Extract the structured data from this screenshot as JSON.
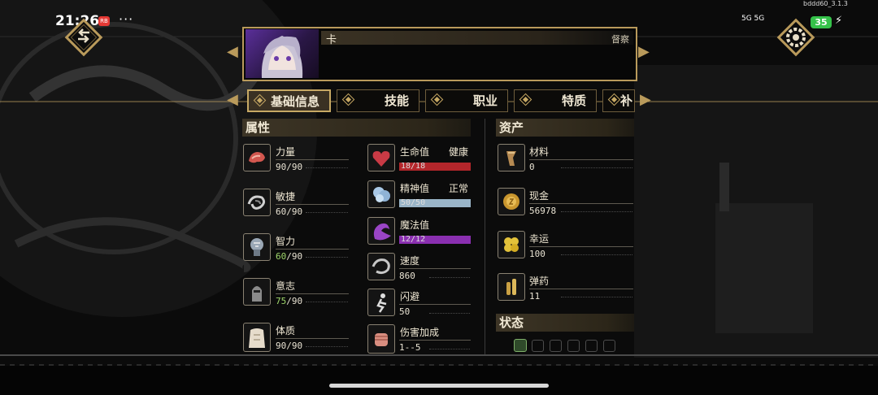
{
  "status_bar": {
    "time": "21:26",
    "app_badge": "RB",
    "dots": "···",
    "network": "5G  5G",
    "battery": "35",
    "version": "bddd60_3.1.3"
  },
  "character": {
    "name": "卡",
    "tag": "督察"
  },
  "tabs": [
    {
      "label": "基础信息",
      "active": true
    },
    {
      "label": "技能"
    },
    {
      "label": "职业"
    },
    {
      "label": "特质"
    },
    {
      "label": "补"
    }
  ],
  "attributes": {
    "title": "属性",
    "items": [
      {
        "label": "力量",
        "value": "90/90",
        "icon": "arm-icon"
      },
      {
        "label": "敏捷",
        "value": "60/90",
        "icon": "swirl-icon"
      },
      {
        "label": "智力",
        "value_highlight": "60",
        "value_rest": "/90",
        "icon": "brain-icon"
      },
      {
        "label": "意志",
        "value_highlight": "75",
        "value_rest": "/90",
        "icon": "knight-icon"
      },
      {
        "label": "体质",
        "value": "90/90",
        "icon": "torso-icon"
      }
    ]
  },
  "vitals": {
    "items": [
      {
        "label": "生命值",
        "status": "健康",
        "value": "18/18",
        "fill": 1.0,
        "color": "#b3262b",
        "icon": "heart-icon"
      },
      {
        "label": "精神值",
        "status": "正常",
        "value": "50/50",
        "fill": 1.0,
        "color": "#9ab5c8",
        "icon": "mind-icon"
      },
      {
        "label": "魔法值",
        "value": "12/12",
        "fill": 1.0,
        "color": "#8a2fb0",
        "icon": "magic-icon"
      }
    ],
    "stats": [
      {
        "label": "速度",
        "value": "860",
        "icon": "speed-icon"
      },
      {
        "label": "闪避",
        "value": "50",
        "icon": "dodge-icon"
      },
      {
        "label": "伤害加成",
        "value": "1--5",
        "icon": "fist-icon"
      }
    ]
  },
  "assets": {
    "title": "资产",
    "items": [
      {
        "label": "材料",
        "value": "0",
        "icon": "material-icon"
      },
      {
        "label": "现金",
        "value": "56978",
        "icon": "coin-icon"
      },
      {
        "label": "幸运",
        "value": "100",
        "icon": "clover-icon"
      },
      {
        "label": "弹药",
        "value": "11",
        "icon": "ammo-icon"
      }
    ]
  },
  "status_section": {
    "title": "状态",
    "slot_count": 5
  },
  "colors": {
    "gold": "#b99a5b",
    "highlight_green": "#9fd66b"
  }
}
